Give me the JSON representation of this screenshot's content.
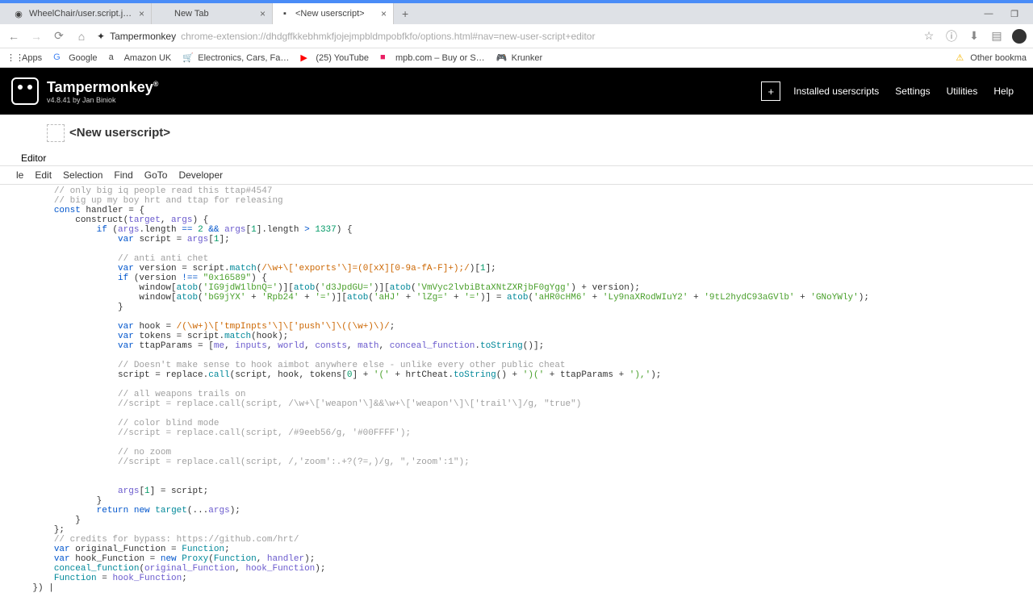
{
  "browser": {
    "tabs": [
      {
        "title": "WheelChair/user.script.js at mas…",
        "favicon": "github"
      },
      {
        "title": "New Tab",
        "favicon": "none"
      },
      {
        "title": "<New userscript>",
        "favicon": "tm",
        "active": true
      }
    ],
    "url_host": "Tampermonkey",
    "url_path": "chrome-extension://dhdgffkkebhmkfjojejmpbldmpobfkfo/options.html#nav=new-user-script+editor",
    "bookmarks": [
      {
        "label": "Apps",
        "icon": "apps"
      },
      {
        "label": "Google",
        "icon": "g"
      },
      {
        "label": "Amazon UK",
        "icon": "amazon"
      },
      {
        "label": "Electronics, Cars, Fa…",
        "icon": "ebay"
      },
      {
        "label": "(25) YouTube",
        "icon": "yt"
      },
      {
        "label": "mpb.com – Buy or S…",
        "icon": "mpb"
      },
      {
        "label": "Krunker",
        "icon": "krunker"
      }
    ],
    "other_bookmarks": "Other bookma"
  },
  "tampermonkey": {
    "brand": "Tampermonkey",
    "version_line": "v4.8.41 by Jan Biniok",
    "nav": {
      "installed": "Installed userscripts",
      "settings": "Settings",
      "utilities": "Utilities",
      "help": "Help"
    }
  },
  "page": {
    "title": "<New userscript>",
    "editor_tab": "Editor"
  },
  "menu": {
    "file": "le",
    "edit": "Edit",
    "selection": "Selection",
    "find": "Find",
    "goto": "GoTo",
    "developer": "Developer"
  },
  "code": {
    "lines": [
      {
        "indent": 2,
        "segs": [
          [
            "com",
            "// only big iq people read this ttap#4547"
          ]
        ]
      },
      {
        "indent": 2,
        "segs": [
          [
            "com",
            "// big up my boy hrt and ttap for releasing"
          ]
        ]
      },
      {
        "indent": 2,
        "segs": [
          [
            "kw",
            "const"
          ],
          [
            "id",
            " handler "
          ],
          [
            "id",
            "= {"
          ]
        ]
      },
      {
        "indent": 3,
        "segs": [
          [
            "id",
            "construct("
          ],
          [
            "prop",
            "target"
          ],
          [
            "id",
            ", "
          ],
          [
            "prop",
            "args"
          ],
          [
            "id",
            ") {"
          ]
        ]
      },
      {
        "indent": 4,
        "segs": [
          [
            "kw",
            "if"
          ],
          [
            "id",
            " ("
          ],
          [
            "prop",
            "args"
          ],
          [
            "id",
            ".length "
          ],
          [
            "kw",
            "=="
          ],
          [
            "id",
            " "
          ],
          [
            "num",
            "2"
          ],
          [
            "id",
            " "
          ],
          [
            "kw",
            "&&"
          ],
          [
            "id",
            " "
          ],
          [
            "prop",
            "args"
          ],
          [
            "id",
            "["
          ],
          [
            "num",
            "1"
          ],
          [
            "id",
            "].length "
          ],
          [
            "kw",
            ">"
          ],
          [
            "id",
            " "
          ],
          [
            "num",
            "1337"
          ],
          [
            "id",
            ") {"
          ]
        ]
      },
      {
        "indent": 5,
        "segs": [
          [
            "kw",
            "var"
          ],
          [
            "id",
            " script "
          ],
          [
            "id",
            "= "
          ],
          [
            "prop",
            "args"
          ],
          [
            "id",
            "["
          ],
          [
            "num",
            "1"
          ],
          [
            "id",
            "];"
          ]
        ]
      },
      {
        "indent": 0,
        "segs": [
          [
            "id",
            ""
          ]
        ]
      },
      {
        "indent": 5,
        "segs": [
          [
            "com",
            "// anti anti chet"
          ]
        ]
      },
      {
        "indent": 5,
        "segs": [
          [
            "kw",
            "var"
          ],
          [
            "id",
            " version "
          ],
          [
            "id",
            "= script."
          ],
          [
            "fn",
            "match"
          ],
          [
            "id",
            "("
          ],
          [
            "str",
            "/\\w+\\['exports'\\]=(0[xX][0-9a-fA-F]+);/"
          ],
          [
            "id",
            ")["
          ],
          [
            "num",
            "1"
          ],
          [
            "id",
            "];"
          ]
        ]
      },
      {
        "indent": 5,
        "segs": [
          [
            "kw",
            "if"
          ],
          [
            "id",
            " (version "
          ],
          [
            "kw",
            "!=="
          ],
          [
            "id",
            " "
          ],
          [
            "str2",
            "\"0x16589\""
          ],
          [
            "id",
            ") {"
          ]
        ]
      },
      {
        "indent": 6,
        "segs": [
          [
            "id",
            "window["
          ],
          [
            "fn",
            "atob"
          ],
          [
            "id",
            "("
          ],
          [
            "str2",
            "'IG9jdW1lbnQ='"
          ],
          [
            "id",
            ")]["
          ],
          [
            "fn",
            "atob"
          ],
          [
            "id",
            "("
          ],
          [
            "str2",
            "'d3JpdGU='"
          ],
          [
            "id",
            ")]["
          ],
          [
            "fn",
            "atob"
          ],
          [
            "id",
            "("
          ],
          [
            "str2",
            "'VmVyc2lvbiBtaXNtZXRjbF0gYgg'"
          ],
          [
            "id",
            ") + version);"
          ]
        ]
      },
      {
        "indent": 6,
        "segs": [
          [
            "id",
            "window["
          ],
          [
            "fn",
            "atob"
          ],
          [
            "id",
            "("
          ],
          [
            "str2",
            "'bG9jYX'"
          ],
          [
            "id",
            " + "
          ],
          [
            "str2",
            "'Rpb24'"
          ],
          [
            "id",
            " + "
          ],
          [
            "str2",
            "'='"
          ],
          [
            "id",
            ")]["
          ],
          [
            "fn",
            "atob"
          ],
          [
            "id",
            "("
          ],
          [
            "str2",
            "'aHJ'"
          ],
          [
            "id",
            " + "
          ],
          [
            "str2",
            "'lZg='"
          ],
          [
            "id",
            " + "
          ],
          [
            "str2",
            "'='"
          ],
          [
            "id",
            ")] = "
          ],
          [
            "fn",
            "atob"
          ],
          [
            "id",
            "("
          ],
          [
            "str2",
            "'aHR0cHM6'"
          ],
          [
            "id",
            " + "
          ],
          [
            "str2",
            "'Ly9naXRodWIuY2'"
          ],
          [
            "id",
            " + "
          ],
          [
            "str2",
            "'9tL2hydC93aGVlb'"
          ],
          [
            "id",
            " + "
          ],
          [
            "str2",
            "'GNoYWly'"
          ],
          [
            "id",
            ");"
          ]
        ]
      },
      {
        "indent": 5,
        "segs": [
          [
            "id",
            "}"
          ]
        ]
      },
      {
        "indent": 0,
        "segs": [
          [
            "id",
            ""
          ]
        ]
      },
      {
        "indent": 5,
        "segs": [
          [
            "kw",
            "var"
          ],
          [
            "id",
            " hook "
          ],
          [
            "id",
            "= "
          ],
          [
            "str",
            "/(\\w+)\\['tmpInpts'\\]\\['push'\\]\\((\\w+)\\)/"
          ],
          [
            "id",
            ";"
          ]
        ]
      },
      {
        "indent": 5,
        "segs": [
          [
            "kw",
            "var"
          ],
          [
            "id",
            " tokens "
          ],
          [
            "id",
            "= script."
          ],
          [
            "fn",
            "match"
          ],
          [
            "id",
            "(hook);"
          ]
        ]
      },
      {
        "indent": 5,
        "segs": [
          [
            "kw",
            "var"
          ],
          [
            "id",
            " ttapParams "
          ],
          [
            "id",
            "= ["
          ],
          [
            "prop",
            "me"
          ],
          [
            "id",
            ", "
          ],
          [
            "prop",
            "inputs"
          ],
          [
            "id",
            ", "
          ],
          [
            "prop",
            "world"
          ],
          [
            "id",
            ", "
          ],
          [
            "prop",
            "consts"
          ],
          [
            "id",
            ", "
          ],
          [
            "prop",
            "math"
          ],
          [
            "id",
            ", "
          ],
          [
            "prop",
            "conceal_function"
          ],
          [
            "id",
            "."
          ],
          [
            "fn",
            "toString"
          ],
          [
            "id",
            "()];"
          ]
        ]
      },
      {
        "indent": 0,
        "segs": [
          [
            "id",
            ""
          ]
        ]
      },
      {
        "indent": 5,
        "segs": [
          [
            "com",
            "// Doesn't make sense to hook aimbot anywhere else - unlike every other public cheat"
          ]
        ]
      },
      {
        "indent": 5,
        "segs": [
          [
            "id",
            "script "
          ],
          [
            "id",
            "= replace."
          ],
          [
            "fn",
            "call"
          ],
          [
            "id",
            "(script, hook, tokens["
          ],
          [
            "num",
            "0"
          ],
          [
            "id",
            "] + "
          ],
          [
            "str2",
            "'('"
          ],
          [
            "id",
            " + hrtCheat."
          ],
          [
            "fn",
            "toString"
          ],
          [
            "id",
            "() + "
          ],
          [
            "str2",
            "')('"
          ],
          [
            "id",
            " + ttapParams + "
          ],
          [
            "str2",
            "'),'"
          ],
          [
            "id",
            ");"
          ]
        ]
      },
      {
        "indent": 0,
        "segs": [
          [
            "id",
            ""
          ]
        ]
      },
      {
        "indent": 5,
        "segs": [
          [
            "com",
            "// all weapons trails on"
          ]
        ]
      },
      {
        "indent": 5,
        "segs": [
          [
            "com",
            "//script = replace.call(script, /\\w+\\['weapon'\\]&&\\w+\\['weapon'\\]\\['trail'\\]/g, \"true\")"
          ]
        ]
      },
      {
        "indent": 0,
        "segs": [
          [
            "id",
            ""
          ]
        ]
      },
      {
        "indent": 5,
        "segs": [
          [
            "com",
            "// color blind mode"
          ]
        ]
      },
      {
        "indent": 5,
        "segs": [
          [
            "com",
            "//script = replace.call(script, /#9eeb56/g, '#00FFFF');"
          ]
        ]
      },
      {
        "indent": 0,
        "segs": [
          [
            "id",
            ""
          ]
        ]
      },
      {
        "indent": 5,
        "segs": [
          [
            "com",
            "// no zoom"
          ]
        ]
      },
      {
        "indent": 5,
        "segs": [
          [
            "com",
            "//script = replace.call(script, /,'zoom':.+?(?=,)/g, \",'zoom':1\");"
          ]
        ]
      },
      {
        "indent": 0,
        "segs": [
          [
            "id",
            ""
          ]
        ]
      },
      {
        "indent": 0,
        "segs": [
          [
            "id",
            ""
          ]
        ]
      },
      {
        "indent": 5,
        "segs": [
          [
            "prop",
            "args"
          ],
          [
            "id",
            "["
          ],
          [
            "num",
            "1"
          ],
          [
            "id",
            "] = script;"
          ]
        ]
      },
      {
        "indent": 4,
        "segs": [
          [
            "id",
            "}"
          ]
        ]
      },
      {
        "indent": 4,
        "segs": [
          [
            "kw",
            "return"
          ],
          [
            "id",
            " "
          ],
          [
            "kw",
            "new"
          ],
          [
            "id",
            " "
          ],
          [
            "fn",
            "target"
          ],
          [
            "id",
            "(..."
          ],
          [
            "prop",
            "args"
          ],
          [
            "id",
            ");"
          ]
        ]
      },
      {
        "indent": 3,
        "segs": [
          [
            "id",
            "}"
          ]
        ]
      },
      {
        "indent": 2,
        "segs": [
          [
            "id",
            "};"
          ]
        ]
      },
      {
        "indent": 2,
        "segs": [
          [
            "com",
            "// credits for bypass: https://github.com/hrt/"
          ]
        ]
      },
      {
        "indent": 2,
        "segs": [
          [
            "kw",
            "var"
          ],
          [
            "id",
            " original_Function "
          ],
          [
            "id",
            "= "
          ],
          [
            "fn",
            "Function"
          ],
          [
            "id",
            ";"
          ]
        ]
      },
      {
        "indent": 2,
        "segs": [
          [
            "kw",
            "var"
          ],
          [
            "id",
            " hook_Function "
          ],
          [
            "id",
            "= "
          ],
          [
            "kw",
            "new"
          ],
          [
            "id",
            " "
          ],
          [
            "fn",
            "Proxy"
          ],
          [
            "id",
            "("
          ],
          [
            "fn",
            "Function"
          ],
          [
            "id",
            ", "
          ],
          [
            "prop",
            "handler"
          ],
          [
            "id",
            ");"
          ]
        ]
      },
      {
        "indent": 2,
        "segs": [
          [
            "fn",
            "conceal_function"
          ],
          [
            "id",
            "("
          ],
          [
            "prop",
            "original_Function"
          ],
          [
            "id",
            ", "
          ],
          [
            "prop",
            "hook_Function"
          ],
          [
            "id",
            ");"
          ]
        ]
      },
      {
        "indent": 2,
        "segs": [
          [
            "fn",
            "Function"
          ],
          [
            "id",
            " = "
          ],
          [
            "prop",
            "hook_Function"
          ],
          [
            "id",
            ";"
          ]
        ]
      },
      {
        "indent": 1,
        "segs": [
          [
            "id",
            "}) |"
          ]
        ]
      }
    ]
  }
}
